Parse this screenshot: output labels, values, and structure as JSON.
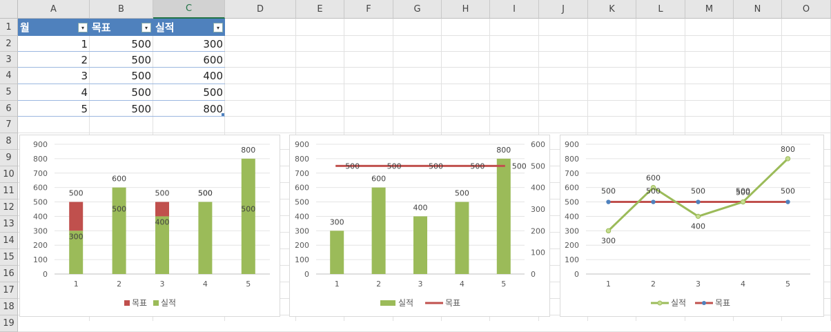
{
  "columns": [
    "A",
    "B",
    "C",
    "D",
    "E",
    "F",
    "G",
    "H",
    "I",
    "J",
    "K",
    "L",
    "M",
    "N",
    "O"
  ],
  "rows": [
    "1",
    "2",
    "3",
    "4",
    "5",
    "6",
    "7",
    "8",
    "9",
    "10",
    "11",
    "12",
    "13",
    "14",
    "15",
    "16",
    "17",
    "18",
    "19"
  ],
  "selected_column": "C",
  "table": {
    "headers": [
      "월",
      "목표",
      "실적"
    ],
    "filter_glyph": "▾",
    "rows": [
      [
        "1",
        "500",
        "300"
      ],
      [
        "2",
        "500",
        "600"
      ],
      [
        "3",
        "500",
        "400"
      ],
      [
        "4",
        "500",
        "500"
      ],
      [
        "5",
        "500",
        "800"
      ]
    ]
  },
  "colors": {
    "target": "#c0504d",
    "actual": "#9bbb59",
    "marker": "#4f81bd",
    "table_header": "#4f81bd"
  },
  "chart_data": [
    {
      "type": "bar",
      "stacked": true,
      "categories": [
        "1",
        "2",
        "3",
        "4",
        "5"
      ],
      "series": [
        {
          "name": "목표",
          "values": [
            500,
            500,
            500,
            500,
            500
          ]
        },
        {
          "name": "실적",
          "values": [
            300,
            600,
            400,
            500,
            800
          ]
        }
      ],
      "ylim": [
        0,
        900
      ],
      "y_ticks": [
        "0",
        "100",
        "200",
        "300",
        "400",
        "500",
        "600",
        "700",
        "800",
        "900"
      ],
      "legend": [
        "목표",
        "실적"
      ],
      "legend_position": "bottom",
      "grid": true
    },
    {
      "type": "bar",
      "combo": "bar + line on secondary axis",
      "categories": [
        "1",
        "2",
        "3",
        "4",
        "5"
      ],
      "series": [
        {
          "name": "실적",
          "type": "bar",
          "values": [
            300,
            600,
            400,
            500,
            800
          ]
        },
        {
          "name": "목표",
          "type": "line",
          "axis": "secondary",
          "values": [
            500,
            500,
            500,
            500,
            500
          ]
        }
      ],
      "ylim": [
        0,
        900
      ],
      "y2lim": [
        0,
        600
      ],
      "y_ticks": [
        "0",
        "100",
        "200",
        "300",
        "400",
        "500",
        "600",
        "700",
        "800",
        "900"
      ],
      "y2_ticks": [
        "0",
        "100",
        "200",
        "300",
        "400",
        "500",
        "600"
      ],
      "legend": [
        "실적",
        "목표"
      ],
      "legend_position": "bottom",
      "grid": true
    },
    {
      "type": "line",
      "categories": [
        "1",
        "2",
        "3",
        "4",
        "5"
      ],
      "series": [
        {
          "name": "실적",
          "values": [
            300,
            600,
            400,
            500,
            800
          ]
        },
        {
          "name": "목표",
          "values": [
            500,
            500,
            500,
            500,
            500
          ]
        }
      ],
      "ylim": [
        0,
        900
      ],
      "y_ticks": [
        "0",
        "100",
        "200",
        "300",
        "400",
        "500",
        "600",
        "700",
        "800",
        "900"
      ],
      "legend": [
        "실적",
        "목표"
      ],
      "legend_position": "bottom",
      "grid": true
    }
  ]
}
